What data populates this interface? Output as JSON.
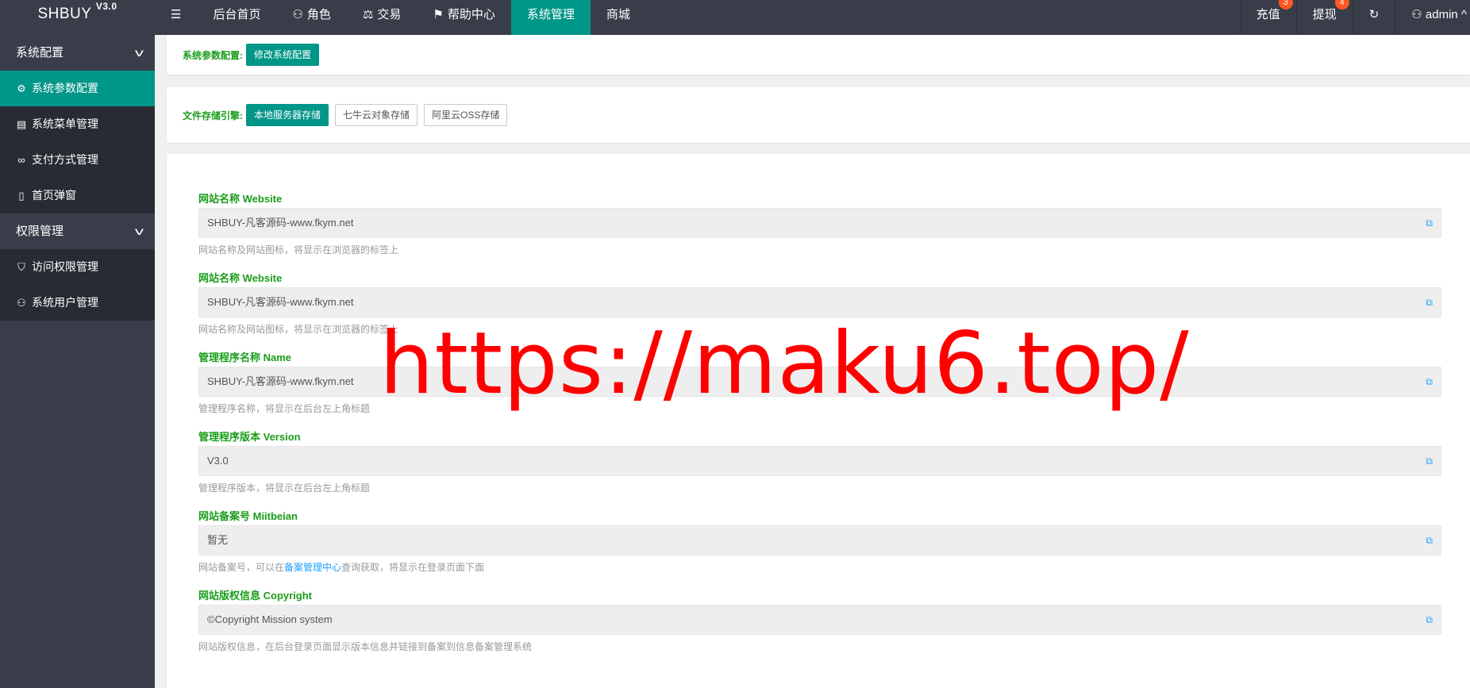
{
  "app": {
    "name": "SHBUY",
    "version": "V3.0"
  },
  "topnav": {
    "menu_icon": "menu-icon",
    "items": [
      {
        "label": "后台首页",
        "icon": ""
      },
      {
        "label": "角色",
        "icon": "user-icon"
      },
      {
        "label": "交易",
        "icon": "scale-icon"
      },
      {
        "label": "帮助中心",
        "icon": "flag-icon"
      },
      {
        "label": "系统管理",
        "icon": "",
        "active": true
      },
      {
        "label": "商城",
        "icon": ""
      }
    ],
    "right": [
      {
        "label": "充值",
        "badge": "3"
      },
      {
        "label": "提现",
        "badge": "4"
      },
      {
        "label": "",
        "icon": "refresh-icon"
      },
      {
        "label": "admin",
        "icon": "user-icon"
      }
    ],
    "accent": "#009688",
    "badge_color": "#ff5722"
  },
  "sidebar": {
    "groups": [
      {
        "label": "系统配置",
        "items": [
          {
            "label": "系统参数配置",
            "icon": "gear-icon",
            "active": true
          },
          {
            "label": "系统菜单管理",
            "icon": "table-icon"
          },
          {
            "label": "支付方式管理",
            "icon": "link-icon"
          },
          {
            "label": "首页弹窗",
            "icon": "tablet-icon"
          }
        ]
      },
      {
        "label": "权限管理",
        "items": [
          {
            "label": "访问权限管理",
            "icon": "shield-icon"
          },
          {
            "label": "系统用户管理",
            "icon": "user-icon"
          }
        ]
      }
    ]
  },
  "config_bar": {
    "label": "系统参数配置:",
    "button": "修改系统配置"
  },
  "storage_bar": {
    "label": "文件存储引擎:",
    "buttons": [
      "本地服务器存储",
      "七牛云对象存储",
      "阿里云OSS存储"
    ]
  },
  "fields": [
    {
      "label": "网站名称 Website",
      "value": "SHBUY-凡客源码-www.fkym.net",
      "help": "网站名称及网站图标，将显示在浏览器的标签上"
    },
    {
      "label": "网站名称 Website",
      "value": "SHBUY-凡客源码-www.fkym.net",
      "help": "网站名称及网站图标，将显示在浏览器的标签上"
    },
    {
      "label": "管理程序名称 Name",
      "value": "SHBUY-凡客源码-www.fkym.net",
      "help": "管理程序名称，将显示在后台左上角标题"
    },
    {
      "label": "管理程序版本 Version",
      "value": "V3.0",
      "help": "管理程序版本，将显示在后台左上角标题"
    },
    {
      "label": "网站备案号 Miitbeian",
      "value": "暂无",
      "help_before": "网站备案号，可以在",
      "help_link": "备案管理中心",
      "help_after": "查询获取，将显示在登录页面下面"
    },
    {
      "label": "网站版权信息 Copyright",
      "value": "©Copyright Mission system",
      "help": "网站版权信息，在后台登录页面显示版本信息并链接到备案到信息备案管理系统"
    }
  ],
  "watermark": "https://maku6.top/"
}
